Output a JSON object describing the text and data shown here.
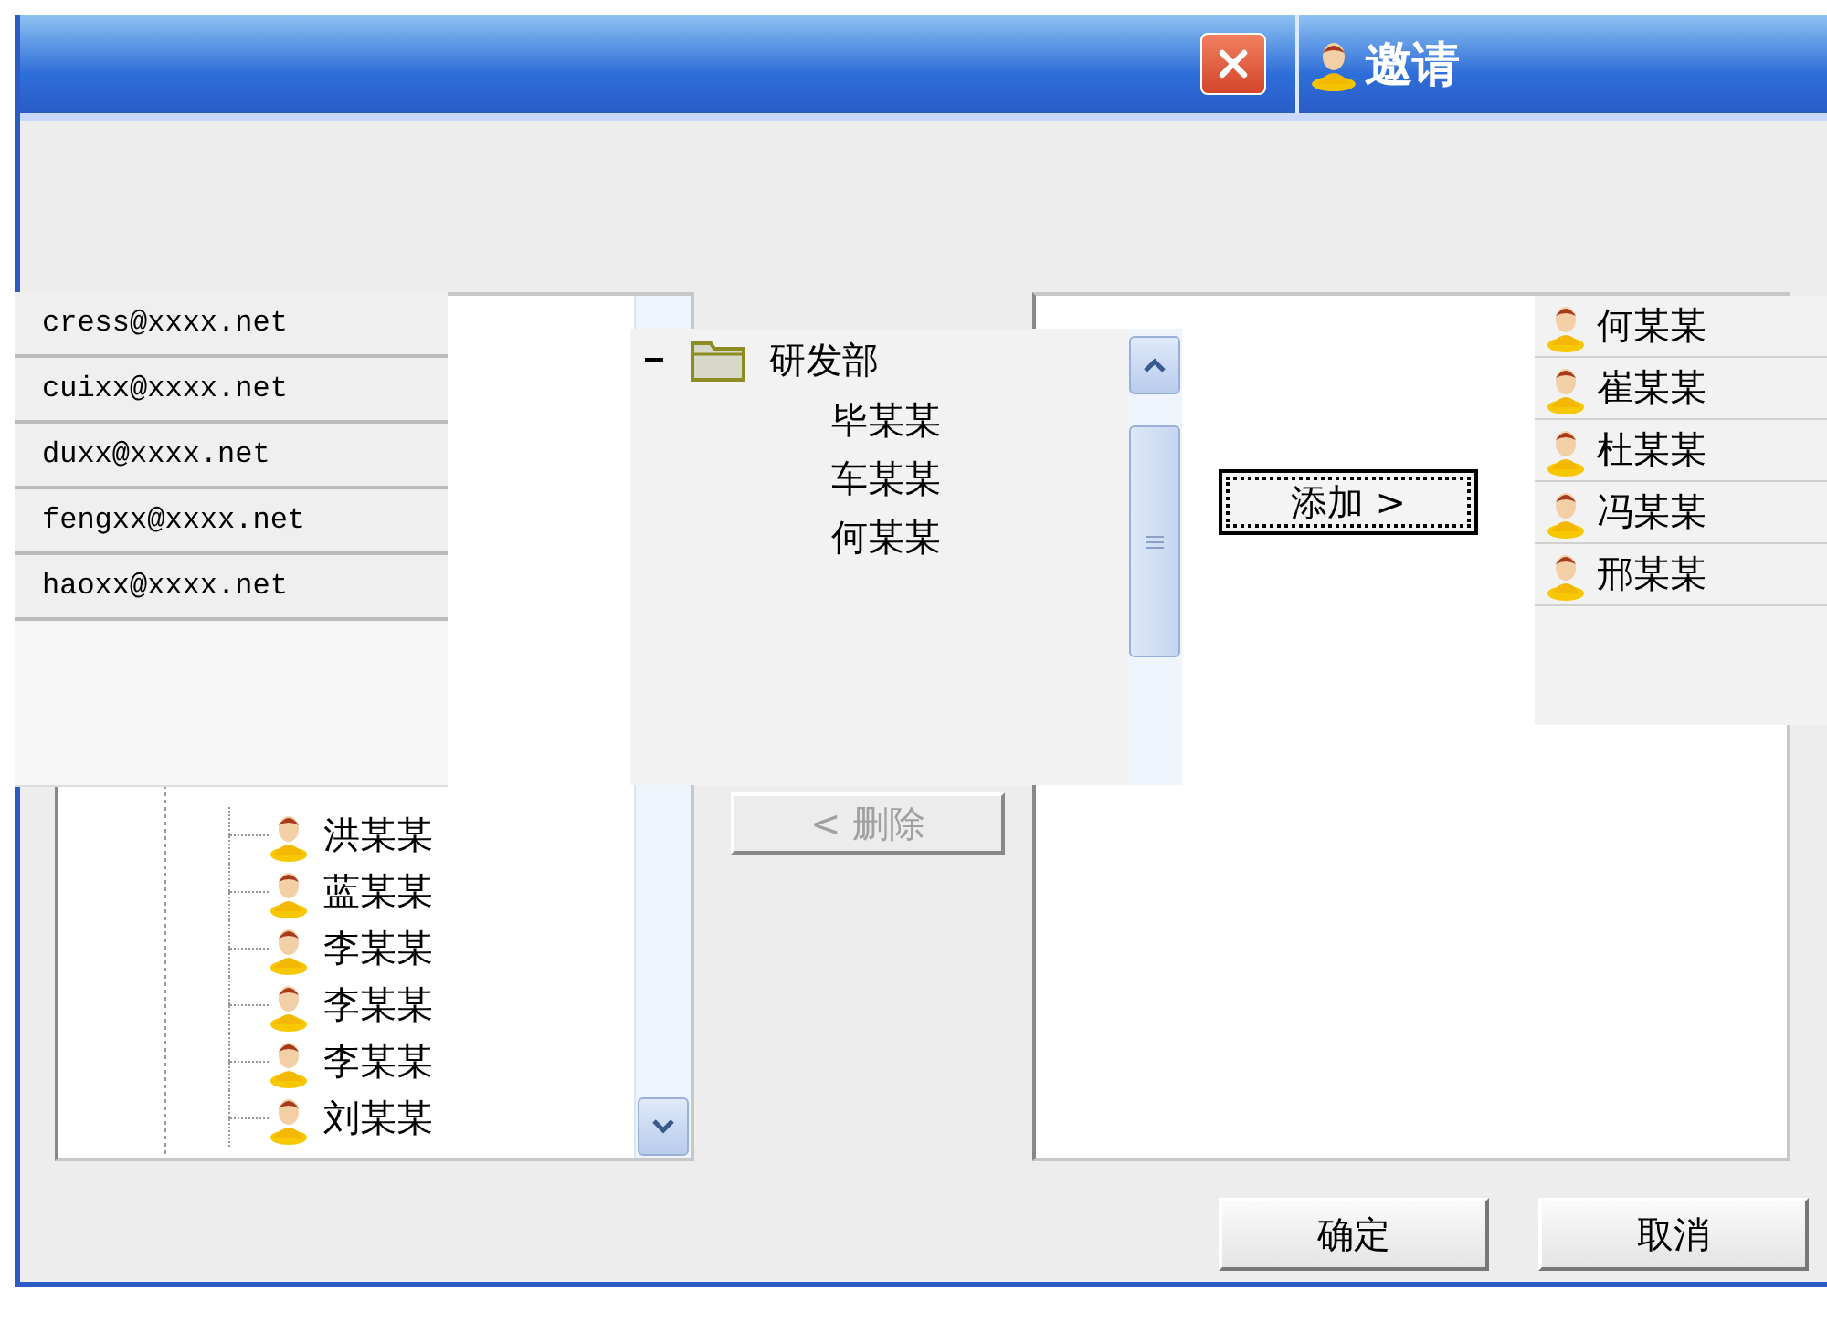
{
  "window": {
    "title": "邀请"
  },
  "email_suggestions": [
    {
      "text": "cress@xxxx.net"
    },
    {
      "text": "cuixx@xxxx.net"
    },
    {
      "text": "duxx@xxxx.net"
    },
    {
      "text": "fengxx@xxxx.net"
    },
    {
      "text": "haoxx@xxxx.net"
    }
  ],
  "tree": {
    "items": [
      {
        "label": "洪某某"
      },
      {
        "label": "蓝某某"
      },
      {
        "label": "李某某"
      },
      {
        "label": "李某某"
      },
      {
        "label": "李某某"
      },
      {
        "label": "刘某某"
      }
    ]
  },
  "department_tree": {
    "label": "研发部",
    "expanded": true,
    "children": [
      {
        "label": "毕某某"
      },
      {
        "label": "车某某"
      },
      {
        "label": "何某某"
      }
    ]
  },
  "delete_button": {
    "label": "< 删除",
    "disabled": true
  },
  "add_button": {
    "label": "添加 >",
    "focused": true
  },
  "selected_list": [
    {
      "label": "何某某"
    },
    {
      "label": "崔某某"
    },
    {
      "label": "杜某某"
    },
    {
      "label": "冯某某"
    },
    {
      "label": "邢某某"
    }
  ],
  "buttons": [
    {
      "label": "确定"
    },
    {
      "label": "取消"
    }
  ]
}
